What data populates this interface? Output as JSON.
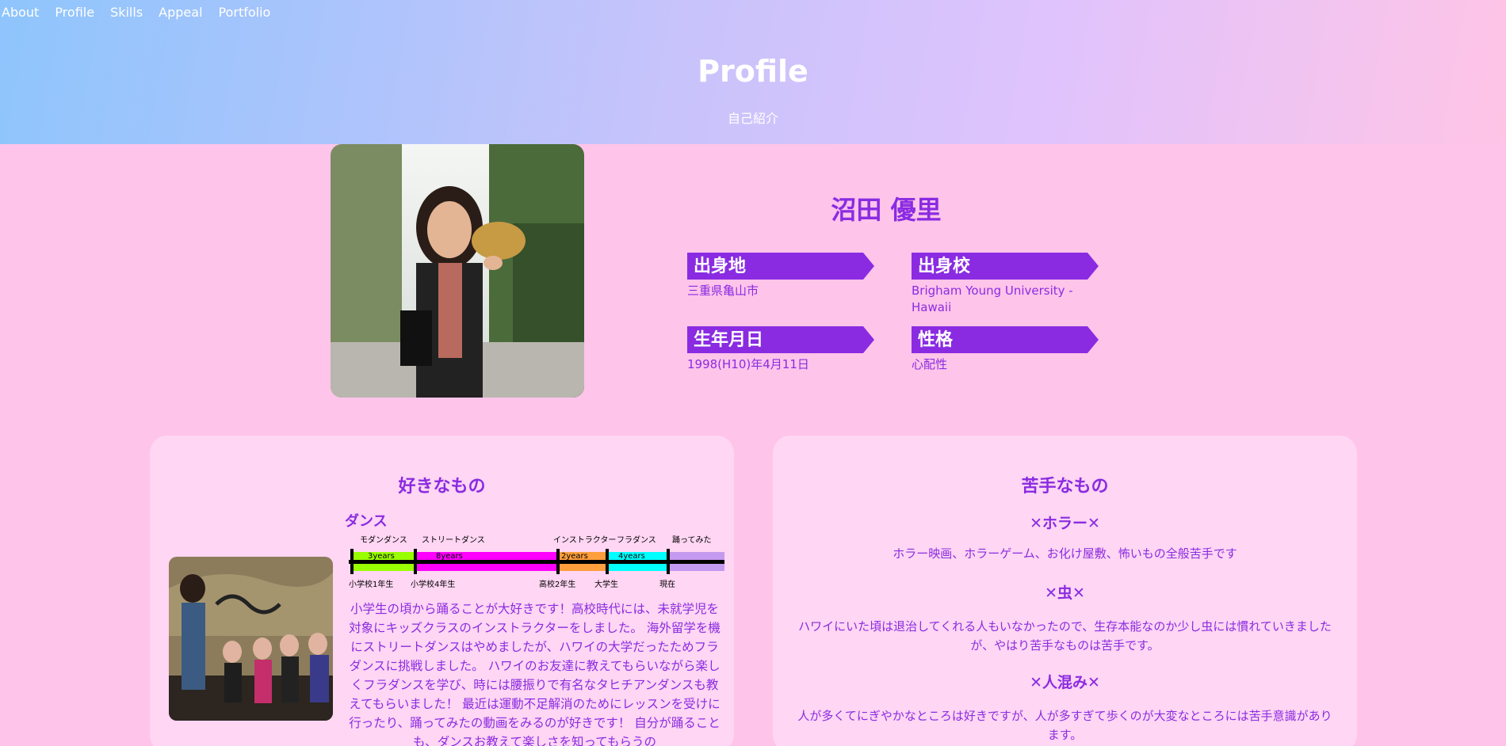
{
  "nav": [
    "About",
    "Profile",
    "Skills",
    "Appeal",
    "Portfolio"
  ],
  "header": {
    "title": "Profile",
    "subtitle": "自己紹介"
  },
  "profile": {
    "name": "沼田 優里",
    "items": [
      {
        "label": "出身地",
        "value": "三重県亀山市"
      },
      {
        "label": "出身校",
        "value": "Brigham Young University - Hawaii"
      },
      {
        "label": "生年月日",
        "value": "1998(H10)年4月11日"
      },
      {
        "label": "性格",
        "value": "心配性"
      }
    ]
  },
  "likes": {
    "title": "好きなもの",
    "subtitle": "ダンス",
    "timeline": {
      "genres": [
        "モダンダンス",
        "ストリートダンス",
        "インストラクター",
        "フラダンス",
        "踊ってみた"
      ],
      "durations": [
        "3years",
        "8years",
        "2years",
        "4years"
      ],
      "milestones": [
        "小学校1年生",
        "小学校4年生",
        "高校2年生",
        "大学生",
        "現在"
      ]
    },
    "text": "小学生の頃から踊ることが大好きです！高校時代には、未就学児を対象にキッズクラスのインストラクターをしました。 海外留学を機にストリートダンスはやめましたが、ハワイの大学だったためフラダンスに挑戦しました。 ハワイのお友達に教えてもらいながら楽しくフラダンスを学び、時には腰振りで有名なタヒチアンダンスも教えてもらいました！ 最近は運動不足解消のためにレッスンを受けに行ったり、踊ってみたの動画をみるのが好きです！ 自分が踊ることも、ダンスお教えて楽しさを知ってもらうの"
  },
  "dislikes": {
    "title": "苦手なもの",
    "items": [
      {
        "heading": "✕ホラー✕",
        "text": "ホラー映画、ホラーゲーム、お化け屋敷、怖いもの全般苦手です"
      },
      {
        "heading": "✕虫✕",
        "text": "ハワイにいた頃は退治してくれる人もいなかったので、生存本能なのか少し虫には慣れていきましたが、やはり苦手なものは苦手です。"
      },
      {
        "heading": "✕人混み✕",
        "text": "人が多くてにぎやかなところは好きですが、人が多すぎて歩くのが大変なところには苦手意識があります。"
      }
    ]
  },
  "colors": {
    "accent": "#8a2be2",
    "background": "#ffc4ea",
    "card": "#ffd6f3"
  }
}
